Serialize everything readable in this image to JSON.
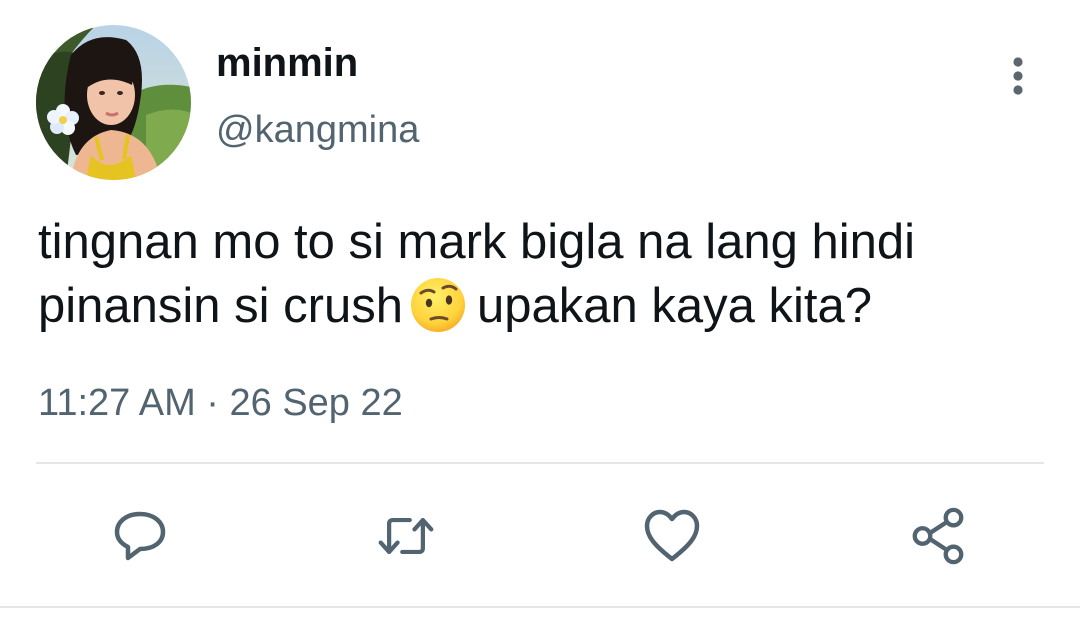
{
  "tweet": {
    "author": {
      "display_name": "minmin",
      "handle": "@kangmina",
      "avatar": "profile-photo"
    },
    "text_line1": "tingnan mo to si mark bigla na lang hindi",
    "text_line2_before_emoji": "pinansin si crush",
    "emoji": "face-with-raised-eyebrow",
    "text_line2_after_emoji": "upakan kaya kita?",
    "timestamp": "11:27 AM · 26 Sep 22"
  },
  "actions": {
    "reply_icon": "speech-bubble-icon",
    "retweet_icon": "retweet-arrows-icon",
    "like_icon": "heart-icon",
    "share_icon": "share-nodes-icon"
  },
  "colors": {
    "text": "#0f1419",
    "secondary": "#536471",
    "divider": "#e3e7ea"
  }
}
